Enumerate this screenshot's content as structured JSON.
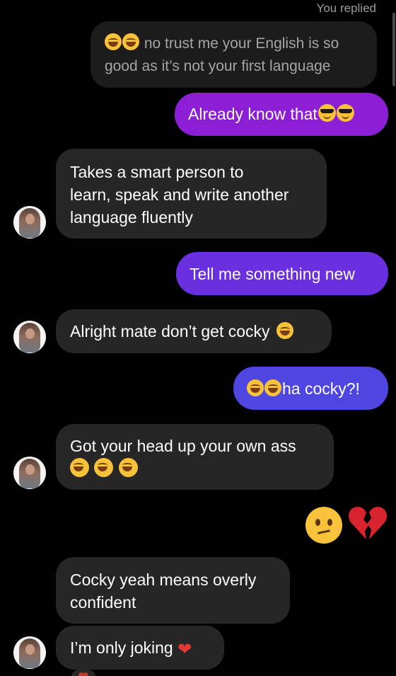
{
  "conversation": {
    "replied_label": "You replied",
    "quoted_message": {
      "emoji": "face-with-tears-of-joy-icon x2",
      "text": "no trust me your English is so good as it’s not your first language"
    },
    "messages": [
      {
        "sender": "me",
        "text": "Already know that",
        "emoji": "smiling-face-with-sunglasses-icon x2",
        "color": "#8c1fd6"
      },
      {
        "sender": "them",
        "lines": [
          "Takes a smart person to",
          "learn, speak and write another",
          "language fluently"
        ]
      },
      {
        "sender": "me",
        "text": "Tell me something new",
        "color": "#6a2fdf"
      },
      {
        "sender": "them",
        "text": "Alright mate don’t get cocky",
        "emoji": "face-with-tears-of-joy-icon"
      },
      {
        "sender": "me",
        "text": "ha cocky?!",
        "emoji": "face-with-tears-of-joy-icon x2",
        "color": "#4f46e2"
      },
      {
        "sender": "them",
        "text": "Got your head up your own ass",
        "emoji": "face-with-tears-of-joy-icon x3"
      },
      {
        "sender": "me",
        "emoji": "confused-face-icon, broken-heart-icon"
      },
      {
        "sender": "them",
        "lines": [
          "Cocky yeah means overly",
          "confident"
        ]
      },
      {
        "sender": "them",
        "text": "I’m only joking",
        "emoji": "red-heart-icon"
      }
    ]
  },
  "colors": {
    "background": "#000000",
    "incoming_bubble": "#262626",
    "quoted_bubble": "#1c1c1c",
    "outgoing_purple": "#8c1fd6",
    "outgoing_violet": "#6a2fdf",
    "outgoing_indigo": "#4f46e2"
  }
}
